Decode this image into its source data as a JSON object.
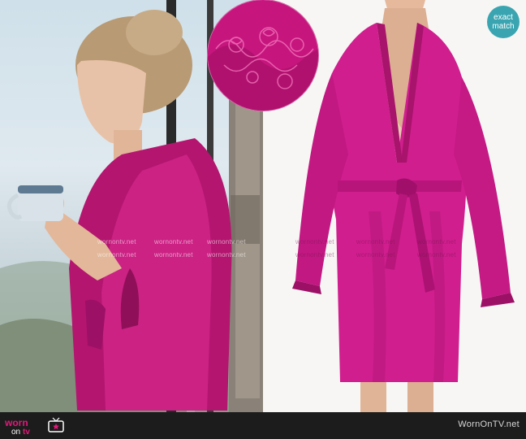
{
  "badge": {
    "line1": "exact",
    "line2": "match"
  },
  "footer": {
    "logo_worn": "worn",
    "logo_on": "on",
    "logo_tv": "tv",
    "site": "WornOnTV.net"
  },
  "watermark": "wornontv.net",
  "colors": {
    "robe": "#d01e8e",
    "robe_shadow": "#9c1066",
    "badge": "#3aa5b0",
    "footer_bg": "#1c1c1c",
    "logo_pink": "#e2187a"
  }
}
